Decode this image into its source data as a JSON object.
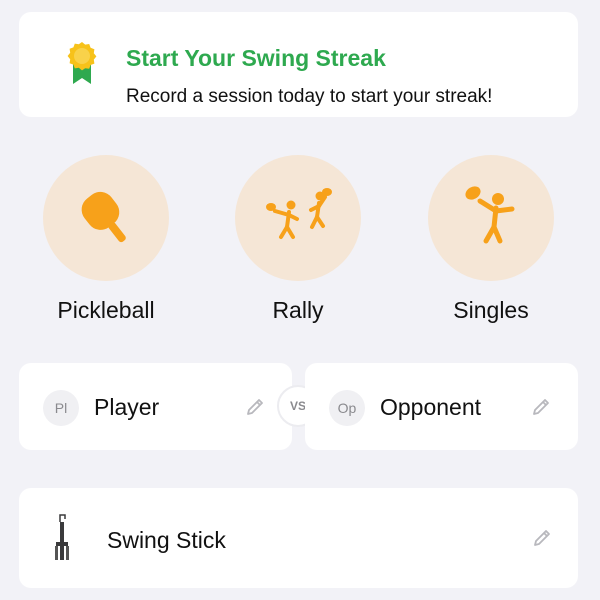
{
  "streak": {
    "title": "Start Your Swing Streak",
    "subtitle": "Record a session today to start your streak!",
    "icon": "award-ribbon-icon",
    "title_color": "#2ea94f"
  },
  "modes": [
    {
      "label": "Pickleball",
      "icon": "paddle-icon"
    },
    {
      "label": "Rally",
      "icon": "rally-players-icon"
    },
    {
      "label": "Singles",
      "icon": "single-player-icon"
    }
  ],
  "accent_color": "#f7a11a",
  "matchup": {
    "player": {
      "initials": "Pl",
      "name": "Player"
    },
    "vs_label": "VS",
    "opponent": {
      "initials": "Op",
      "name": "Opponent"
    }
  },
  "device": {
    "name": "Swing Stick",
    "icon": "swing-stick-icon"
  }
}
